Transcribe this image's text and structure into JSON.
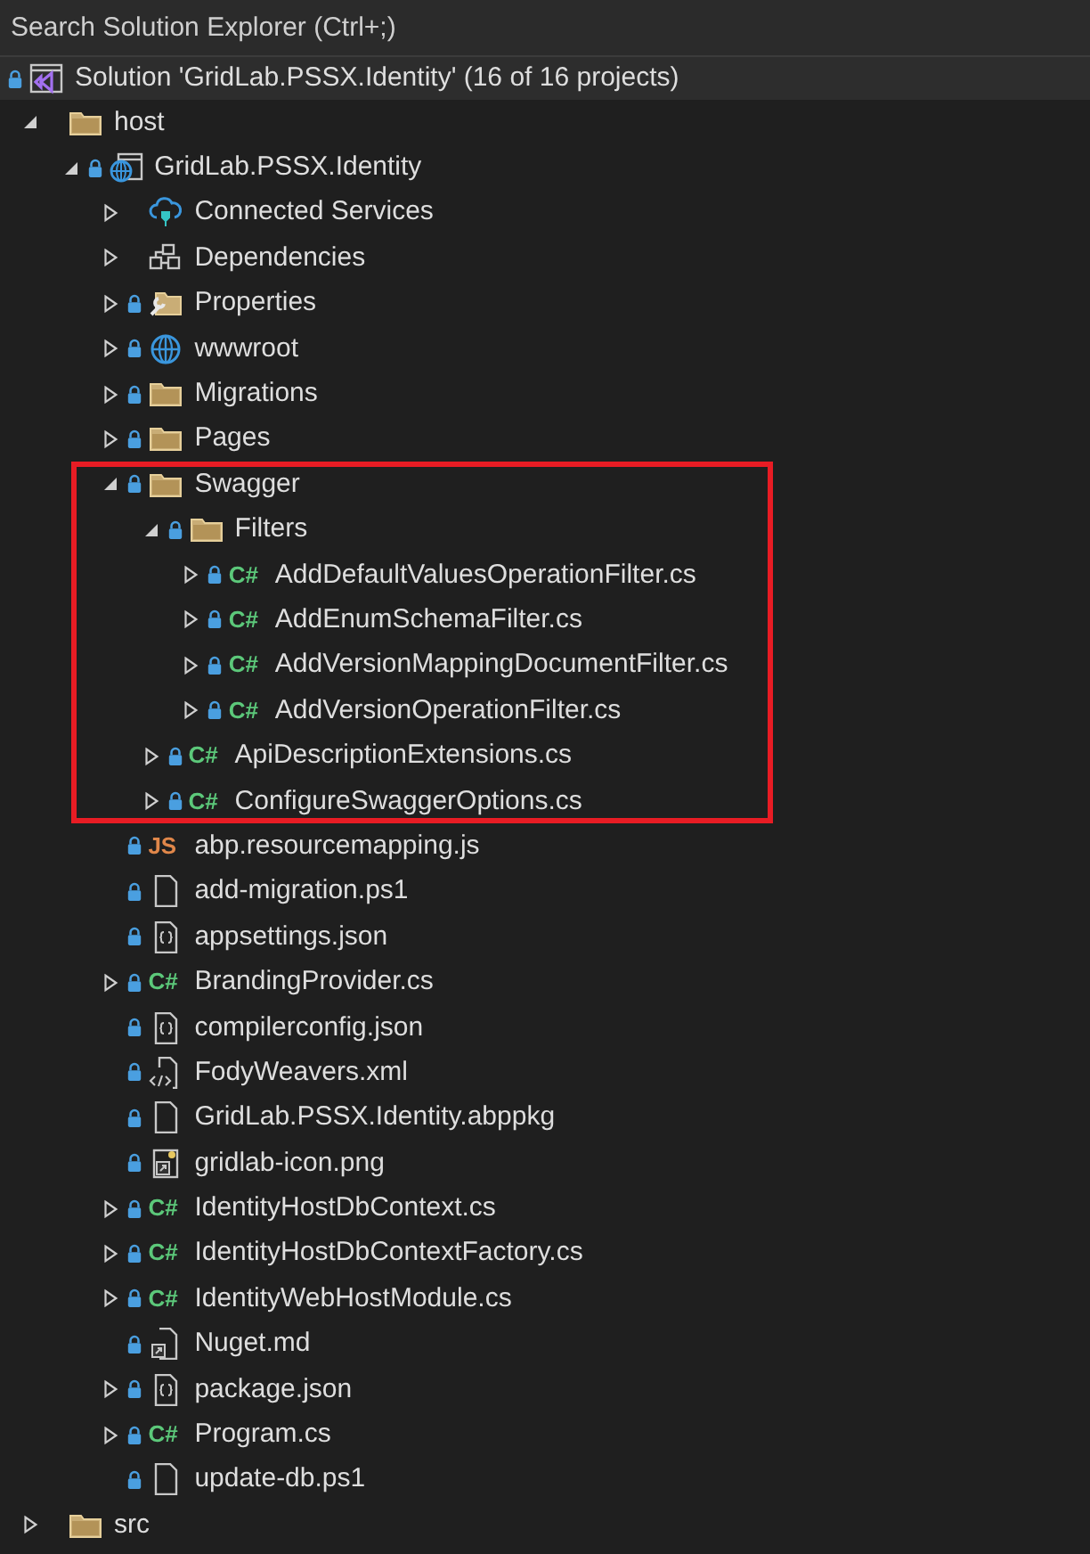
{
  "search": {
    "placeholder": "Search Solution Explorer (Ctrl+;)"
  },
  "solution": {
    "label": "Solution 'GridLab.PSSX.Identity' (16 of 16 projects)",
    "locked": true
  },
  "tree": [
    {
      "label": "host",
      "kind": "folder",
      "locked": false,
      "expanded": true,
      "children": [
        {
          "label": "GridLab.PSSX.Identity",
          "kind": "project",
          "locked": true,
          "expanded": true,
          "children": [
            {
              "label": "Connected Services",
              "kind": "connected",
              "locked": false,
              "expanded": false
            },
            {
              "label": "Dependencies",
              "kind": "dependencies",
              "locked": false,
              "expanded": false
            },
            {
              "label": "Properties",
              "kind": "properties",
              "locked": true,
              "expanded": false
            },
            {
              "label": "wwwroot",
              "kind": "web",
              "locked": true,
              "expanded": false
            },
            {
              "label": "Migrations",
              "kind": "folder",
              "locked": true,
              "expanded": false
            },
            {
              "label": "Pages",
              "kind": "folder",
              "locked": true,
              "expanded": false
            },
            {
              "label": "Swagger",
              "kind": "folder",
              "locked": true,
              "expanded": true,
              "highlighted": true,
              "children": [
                {
                  "label": "Filters",
                  "kind": "folder",
                  "locked": true,
                  "expanded": true,
                  "children": [
                    {
                      "label": "AddDefaultValuesOperationFilter.cs",
                      "kind": "csharp",
                      "badge": "C#",
                      "locked": true,
                      "expanded": false
                    },
                    {
                      "label": "AddEnumSchemaFilter.cs",
                      "kind": "csharp",
                      "badge": "C#",
                      "locked": true,
                      "expanded": false
                    },
                    {
                      "label": "AddVersionMappingDocumentFilter.cs",
                      "kind": "csharp",
                      "badge": "C#",
                      "locked": true,
                      "expanded": false
                    },
                    {
                      "label": "AddVersionOperationFilter.cs",
                      "kind": "csharp",
                      "badge": "C#",
                      "locked": true,
                      "expanded": false
                    }
                  ]
                },
                {
                  "label": "ApiDescriptionExtensions.cs",
                  "kind": "csharp",
                  "badge": "C#",
                  "locked": true,
                  "expanded": false
                },
                {
                  "label": "ConfigureSwaggerOptions.cs",
                  "kind": "csharp",
                  "badge": "C#",
                  "locked": true,
                  "expanded": false
                }
              ]
            },
            {
              "label": "abp.resourcemapping.js",
              "kind": "javascript",
              "badge": "JS",
              "locked": true
            },
            {
              "label": "add-migration.ps1",
              "kind": "file",
              "locked": true
            },
            {
              "label": "appsettings.json",
              "kind": "json",
              "locked": true
            },
            {
              "label": "BrandingProvider.cs",
              "kind": "csharp",
              "badge": "C#",
              "locked": true,
              "expanded": false
            },
            {
              "label": "compilerconfig.json",
              "kind": "json",
              "locked": true
            },
            {
              "label": "FodyWeavers.xml",
              "kind": "xml",
              "locked": true
            },
            {
              "label": "GridLab.PSSX.Identity.abppkg",
              "kind": "file",
              "locked": true
            },
            {
              "label": "gridlab-icon.png",
              "kind": "image",
              "locked": true
            },
            {
              "label": "IdentityHostDbContext.cs",
              "kind": "csharp",
              "badge": "C#",
              "locked": true,
              "expanded": false
            },
            {
              "label": "IdentityHostDbContextFactory.cs",
              "kind": "csharp",
              "badge": "C#",
              "locked": true,
              "expanded": false
            },
            {
              "label": "IdentityWebHostModule.cs",
              "kind": "csharp",
              "badge": "C#",
              "locked": true,
              "expanded": false
            },
            {
              "label": "Nuget.md",
              "kind": "shortcut",
              "locked": true
            },
            {
              "label": "package.json",
              "kind": "json",
              "locked": true,
              "expanded": false
            },
            {
              "label": "Program.cs",
              "kind": "csharp",
              "badge": "C#",
              "locked": true,
              "expanded": false
            },
            {
              "label": "update-db.ps1",
              "kind": "file",
              "locked": true
            }
          ]
        }
      ]
    },
    {
      "label": "src",
      "kind": "folder",
      "locked": false,
      "expanded": false
    }
  ]
}
